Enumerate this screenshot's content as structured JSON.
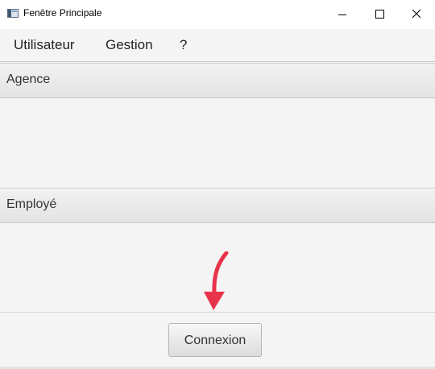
{
  "window": {
    "title": "Fenêtre Principale",
    "app_icon": "java-window-icon",
    "controls": {
      "minimize": "minimize-icon",
      "maximize": "maximize-icon",
      "close": "close-icon"
    }
  },
  "menubar": {
    "items": [
      {
        "label": "Utilisateur"
      },
      {
        "label": "Gestion"
      },
      {
        "label": "?"
      }
    ]
  },
  "panes": [
    {
      "title": "Agence"
    },
    {
      "title": "Employé"
    }
  ],
  "footer": {
    "connexion_label": "Connexion"
  },
  "annotation": {
    "icon": "red-arrow-icon",
    "color": "#e8344b"
  },
  "colors": {
    "window_background": "#f4f4f4",
    "titlebar_background": "#ffffff"
  }
}
